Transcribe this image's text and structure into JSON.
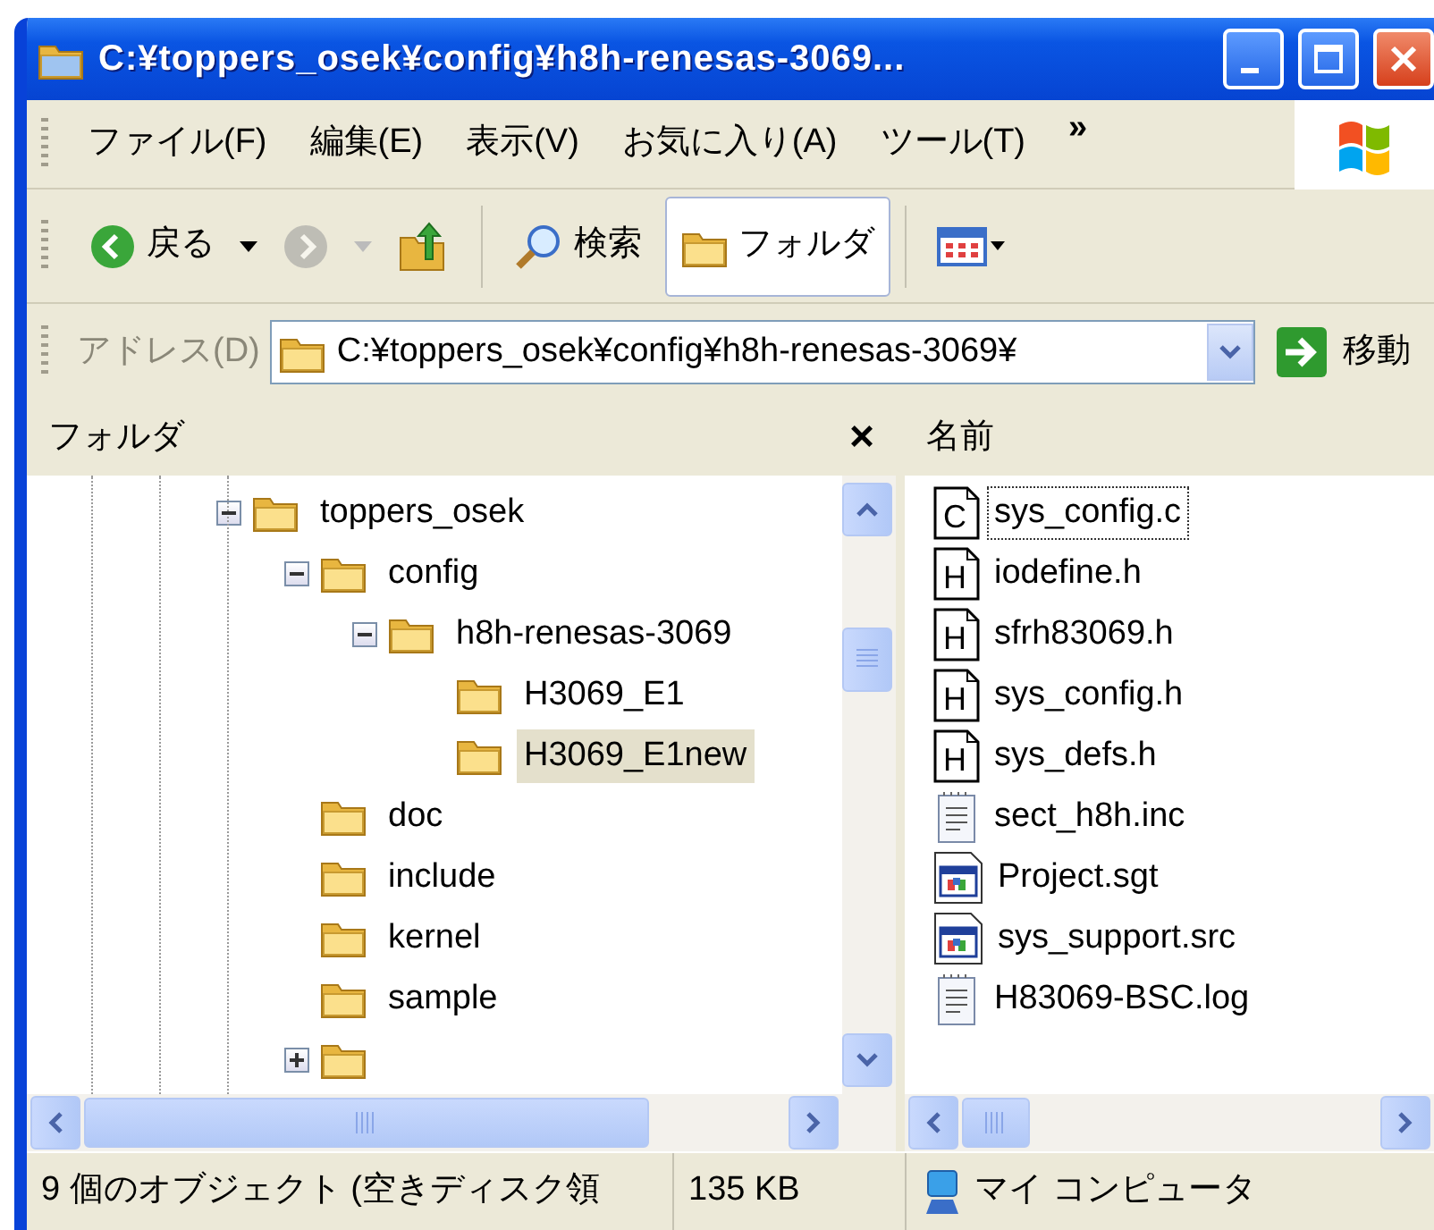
{
  "window": {
    "title": "C:¥toppers_osek¥config¥h8h-renesas-3069..."
  },
  "menu": [
    "ファイル(F)",
    "編集(E)",
    "表示(V)",
    "お気に入り(A)",
    "ツール(T)"
  ],
  "menu_more": "»",
  "toolbar": {
    "back": {
      "label": "戻る",
      "disabled": false
    },
    "forward": {
      "disabled": true
    },
    "search": {
      "label": "検索"
    },
    "folders": {
      "label": "フォルダ",
      "selected": true
    }
  },
  "address": {
    "label": "アドレス(D)",
    "value": "C:¥toppers_osek¥config¥h8h-renesas-3069¥",
    "go": "移動"
  },
  "folder_pane": {
    "title": "フォルダ",
    "close": "×",
    "tree": [
      {
        "label": "toppers_osek",
        "expanded": true,
        "selected": false,
        "children": [
          {
            "label": "config",
            "expanded": true,
            "selected": false,
            "children": [
              {
                "label": "h8h-renesas-3069",
                "expanded": true,
                "selected": false,
                "children": [
                  {
                    "label": "H3069_E1",
                    "selected": false
                  },
                  {
                    "label": "H3069_E1new",
                    "selected": true
                  }
                ]
              }
            ]
          },
          {
            "label": "doc",
            "selected": false
          },
          {
            "label": "include",
            "selected": false
          },
          {
            "label": "kernel",
            "selected": false
          },
          {
            "label": "sample",
            "selected": false
          },
          {
            "expanded": false
          }
        ]
      }
    ]
  },
  "file_pane": {
    "column": "名前",
    "files": [
      {
        "name": "sys_config.c",
        "kind": "source",
        "letter": "C",
        "focused": true
      },
      {
        "name": "iodefine.h",
        "kind": "source",
        "letter": "H",
        "focused": false
      },
      {
        "name": "sfrh83069.h",
        "kind": "source",
        "letter": "H",
        "focused": false
      },
      {
        "name": "sys_config.h",
        "kind": "source",
        "letter": "H",
        "focused": false
      },
      {
        "name": "sys_defs.h",
        "kind": "source",
        "letter": "H",
        "focused": false
      },
      {
        "name": "sect_h8h.inc",
        "kind": "text",
        "focused": false
      },
      {
        "name": "Project.sgt",
        "kind": "app",
        "focused": false
      },
      {
        "name": "sys_support.src",
        "kind": "app",
        "focused": false
      },
      {
        "name": "H83069-BSC.log",
        "kind": "text",
        "focused": false
      }
    ]
  },
  "status_bar": {
    "objects": "9 個のオブジェクト (空きディスク領",
    "size": "135 KB",
    "zone": "マイ コンピュータ"
  }
}
